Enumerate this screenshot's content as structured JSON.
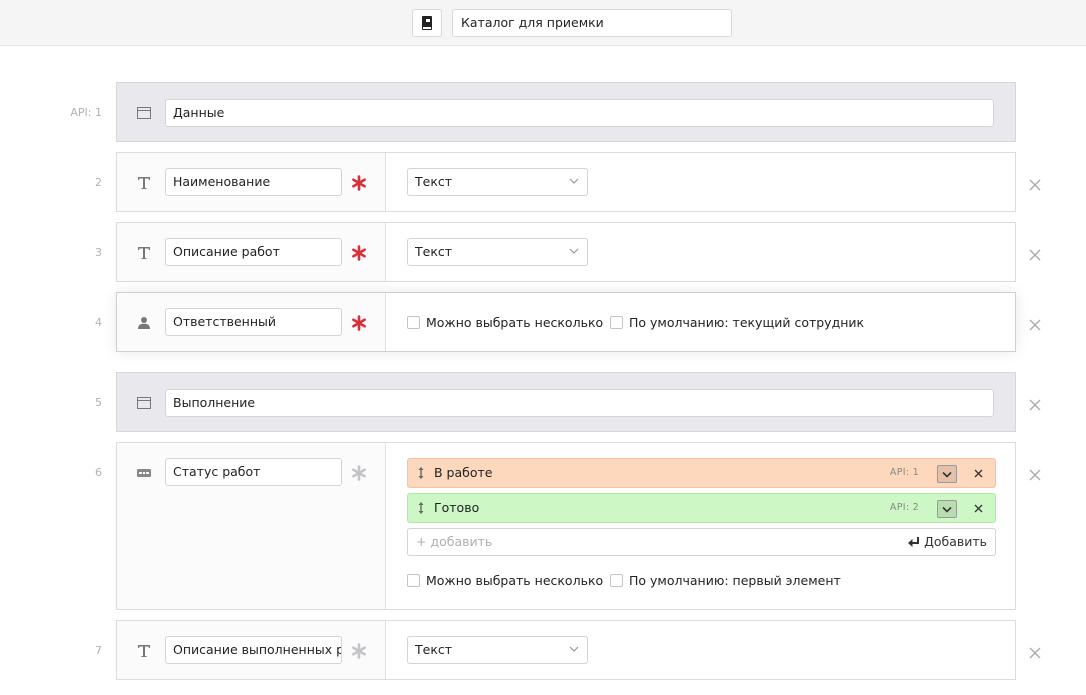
{
  "header": {
    "catalog_icon": "book-icon",
    "catalog_name": "Каталог для приемки"
  },
  "api_prefix": "API: 1",
  "fields": [
    {
      "num": "",
      "type": "section",
      "icon": "section-icon",
      "name": "Данные"
    },
    {
      "num": "2",
      "type": "text",
      "icon": "text-type-icon",
      "name": "Наименование",
      "required": true,
      "type_select": "Текст"
    },
    {
      "num": "3",
      "type": "text",
      "icon": "text-type-icon",
      "name": "Описание работ",
      "required": true,
      "type_select": "Текст"
    },
    {
      "num": "4",
      "type": "user",
      "icon": "user-icon",
      "name": "Ответственный",
      "required": true,
      "options": {
        "multiple": "Можно выбрать несколько",
        "default": "По умолчанию: текущий сотрудник"
      }
    },
    {
      "num": "5",
      "type": "section",
      "icon": "section-icon",
      "name": "Выполнение"
    },
    {
      "num": "6",
      "type": "list",
      "icon": "list-type-icon",
      "name": "Статус работ",
      "required": false,
      "items": [
        {
          "label": "В работе",
          "api": "API: 1",
          "color": "#fdd8bd"
        },
        {
          "label": "Готово",
          "api": "API: 2",
          "color": "#cdf7c5"
        }
      ],
      "add_placeholder": "+ добавить",
      "add_label": "Добавить",
      "options": {
        "multiple": "Можно выбрать несколько",
        "default": "По умолчанию: первый элемент"
      }
    },
    {
      "num": "7",
      "type": "text",
      "icon": "text-type-icon",
      "name": "Описание выполненных работ",
      "required": false,
      "type_select": "Текст"
    }
  ],
  "colors": {
    "required_active": "#d6303a",
    "required_inactive": "#c4c4c8",
    "accent_orange": "#fdd8bd",
    "accent_green": "#cdf7c5"
  }
}
